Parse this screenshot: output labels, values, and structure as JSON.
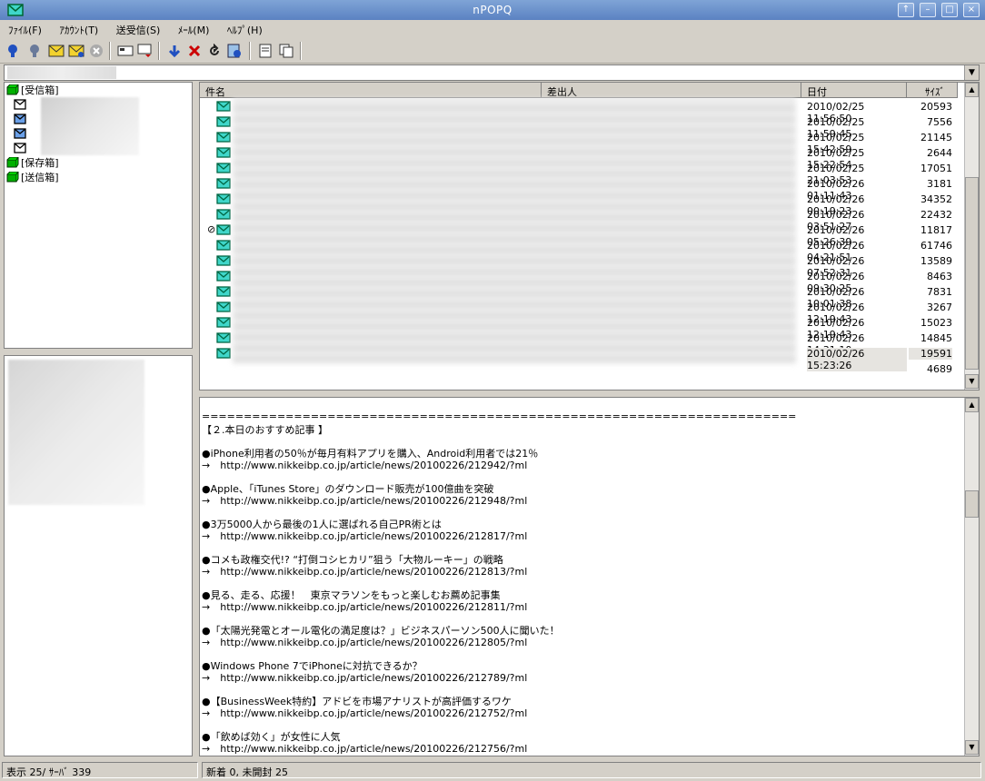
{
  "window": {
    "title": "nPOPQ"
  },
  "menu": [
    "ﾌｧｲﾙ(F)",
    "ｱｶｳﾝﾄ(T)",
    "送受信(S)",
    "ﾒｰﾙ(M)",
    "ﾍﾙﾌﾟ(H)"
  ],
  "toolbar": {
    "icons": [
      "receive-icon",
      "check-icon",
      "send-mail-icon",
      "send-receive-icon",
      "stop-icon",
      "new-mail-icon",
      "reply-icon",
      "download-icon",
      "delete-icon",
      "undo-icon",
      "address-icon",
      "properties-icon",
      "copy-icon"
    ]
  },
  "tree": {
    "inbox": "[受信箱]",
    "saved": "[保存箱]",
    "sent": "[送信箱]"
  },
  "list": {
    "columns": {
      "subject": "件名",
      "sender": "差出人",
      "date": "日付",
      "size": "ｻｲｽﾞ"
    },
    "rows": [
      {
        "date": "2010/02/25 11:56:50",
        "size": "20593"
      },
      {
        "date": "2010/02/25 11:59:45",
        "size": "7556"
      },
      {
        "date": "2010/02/25 15:42:59",
        "size": "21145"
      },
      {
        "date": "2010/02/25 15:22:54",
        "size": "2644"
      },
      {
        "date": "2010/02/25 21:03:53",
        "size": "17051"
      },
      {
        "date": "2010/02/26 01:11:43",
        "size": "3181"
      },
      {
        "date": "2010/02/26 00:19:23",
        "size": "34352"
      },
      {
        "date": "2010/02/26 03:51:27",
        "size": "22432"
      },
      {
        "date": "2010/02/26 05:26:39",
        "size": "11817"
      },
      {
        "date": "2010/02/26 04:21:51",
        "size": "61746"
      },
      {
        "date": "2010/02/26 07:52:31",
        "size": "13589"
      },
      {
        "date": "2010/02/26 09:30:25",
        "size": "8463"
      },
      {
        "date": "2010/02/26 10:01:38",
        "size": "7831"
      },
      {
        "date": "2010/02/26 12:19:43",
        "size": "3267"
      },
      {
        "date": "2010/02/26 12:19:43",
        "size": "15023"
      },
      {
        "date": "2010/02/26 14:31:10",
        "size": "14845"
      },
      {
        "date": "2010/02/26 15:23:26",
        "size": "19591"
      },
      {
        "date": "",
        "size": "4689"
      }
    ]
  },
  "body": {
    "lines": [
      "=======================================================================",
      "【２.本日のおすすめ記事 】",
      "",
      "●iPhone利用者の50％が毎月有料アプリを購入、Android利用者では21％",
      "→　http://www.nikkeibp.co.jp/article/news/20100226/212942/?ml",
      "",
      "●Apple、「iTunes Store」のダウンロード販売が100億曲を突破",
      "→　http://www.nikkeibp.co.jp/article/news/20100226/212948/?ml",
      "",
      "●3万5000人から最後の1人に選ばれる自己PR術とは",
      "→　http://www.nikkeibp.co.jp/article/news/20100226/212817/?ml",
      "",
      "●コメも政権交代!? “打倒コシヒカリ”狙う「大物ルーキー」の戦略",
      "→　http://www.nikkeibp.co.jp/article/news/20100226/212813/?ml",
      "",
      "●見る、走る、応援！　東京マラソンをもっと楽しむお薦め記事集",
      "→　http://www.nikkeibp.co.jp/article/news/20100226/212811/?ml",
      "",
      "●「太陽光発電とオール電化の満足度は？」ビジネスパーソン500人に聞いた！",
      "→　http://www.nikkeibp.co.jp/article/news/20100226/212805/?ml",
      "",
      "●Windows Phone 7でiPhoneに対抗できるか？",
      "→　http://www.nikkeibp.co.jp/article/news/20100226/212789/?ml",
      "",
      "●【BusinessWeek特約】アドビを市場アナリストが高評価するワケ",
      "→　http://www.nikkeibp.co.jp/article/news/20100226/212752/?ml",
      "",
      "●「飲めば効く」が女性に人気",
      "→　http://www.nikkeibp.co.jp/article/news/20100226/212756/?ml"
    ]
  },
  "status": {
    "left": "表示 25/ ｻｰﾊﾞ 339",
    "right": "新着 0, 未開封 25"
  }
}
